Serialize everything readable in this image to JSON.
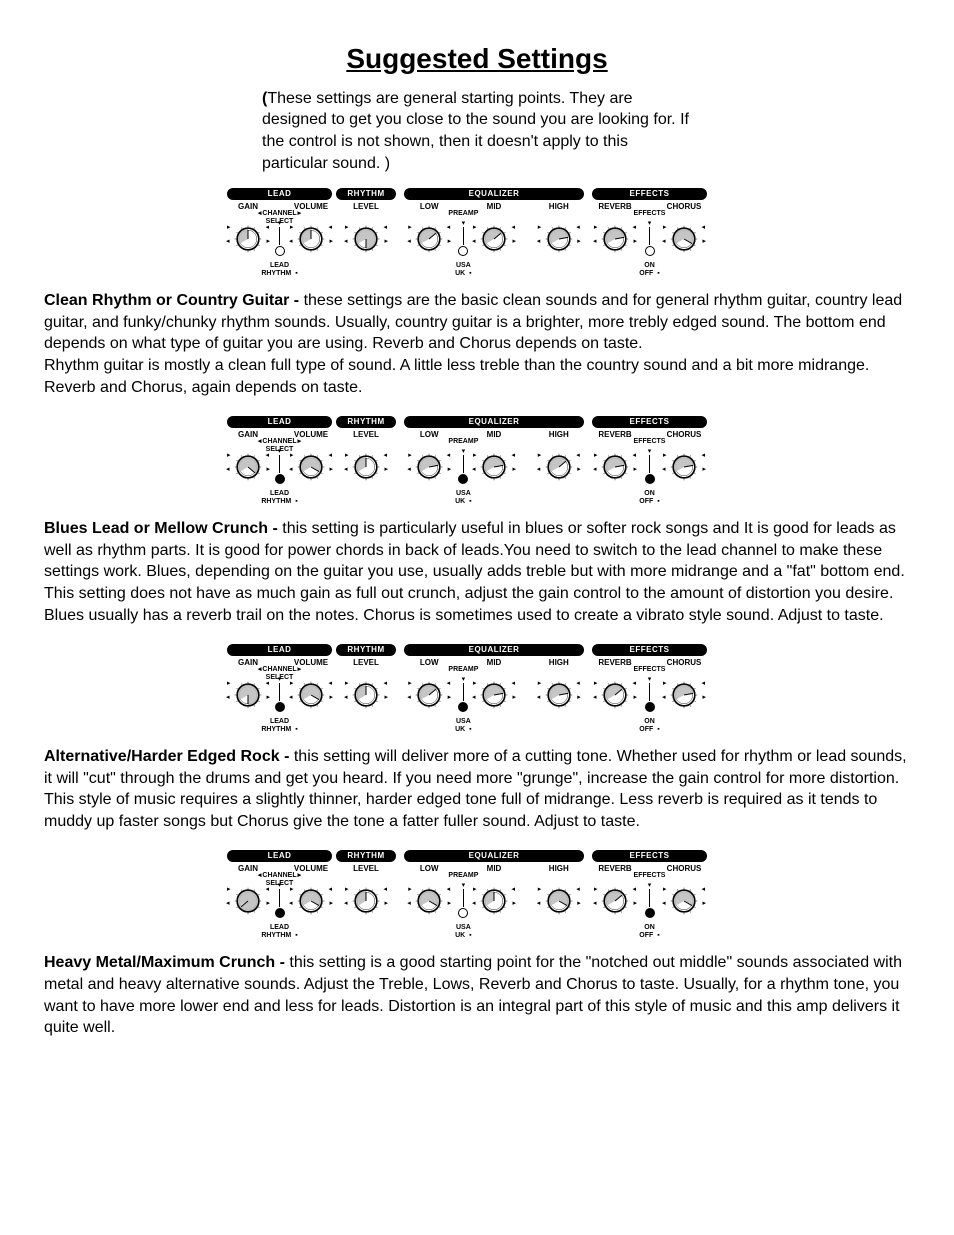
{
  "title": "Suggested Settings",
  "intro_open": "(",
  "intro": "These settings are general starting points. They are designed to get you close to the sound you are looking for. If the control is not shown, then it doesn't apply to this particular sound. )",
  "panel_labels": {
    "lead": "LEAD",
    "rhythm": "RHYTHM",
    "equalizer": "EQUALIZER",
    "effects": "EFFECTS",
    "gain": "GAIN",
    "channel": "CHANNEL",
    "select": "SELECT",
    "volume": "VOLUME",
    "level": "LEVEL",
    "low": "LOW",
    "preamp": "PREAMP",
    "mid": "MID",
    "high": "HIGH",
    "reverb": "REVERB",
    "effects_mid": "EFFECTS",
    "chorus": "CHORUS",
    "lead_rhythm": "LEAD\nRHYTHM",
    "usa_uk": "USA\nUK",
    "on_off": "ON\nOFF"
  },
  "sections": [
    {
      "heading": "Clean Rhythm or Country Guitar -",
      "body": " these settings are the basic clean sounds and for general rhythm guitar, country lead guitar, and funky/chunky rhythm sounds. Usually, country guitar is a brighter, more trebly edged sound. The bottom end depends on what type of guitar you are using. Reverb and Chorus depends on taste.\nRhythm guitar is mostly a clean full type of sound. A little less treble than the country sound and a bit more midrange. Reverb and Chorus, again depends on taste.",
      "panel": {
        "gain": 120,
        "volume": 120,
        "level": 300,
        "low": 170,
        "mid": 170,
        "high": 200,
        "reverb": 200,
        "chorus": 240,
        "channel_filled": false,
        "preamp_filled": false,
        "effects_filled": false
      }
    },
    {
      "heading": "Blues Lead or Mellow Crunch -",
      "body": " this setting is particularly useful in blues or softer rock songs and It is good for leads as well as rhythm parts. It is good for power chords in back of leads.You need to switch to the lead channel to make these settings work. Blues, depending on the guitar you use, usually adds treble but with more midrange and a \"fat\" bottom end. This setting does not have as much gain as full out crunch, adjust the gain control to the amount of distortion you desire.  Blues usually has a reverb trail on the notes. Chorus is sometimes used to create a vibrato style sound. Adjust to taste.",
      "panel": {
        "gain": 250,
        "volume": 240,
        "level": 120,
        "low": 200,
        "mid": 200,
        "high": 170,
        "reverb": 200,
        "chorus": 200,
        "channel_filled": true,
        "preamp_filled": true,
        "effects_filled": true
      }
    },
    {
      "heading": "Alternative/Harder Edged Rock -",
      "body": " this setting will deliver more of a cutting tone. Whether used for rhythm or lead sounds, it will \"cut\"  through the drums and get you heard. If you need more \"grunge\", increase the gain control for more distortion. This style of music requires a  slightly thinner, harder edged tone full of midrange. Less reverb is required as it tends to muddy up faster songs but Chorus give the tone a fatter fuller sound. Adjust to taste.",
      "panel": {
        "gain": 300,
        "volume": 240,
        "level": 120,
        "low": 170,
        "mid": 200,
        "high": 200,
        "reverb": 170,
        "chorus": 200,
        "channel_filled": true,
        "preamp_filled": true,
        "effects_filled": true
      }
    },
    {
      "heading": "Heavy Metal/Maximum Crunch -",
      "body": " this setting is a good starting point for the \"notched out middle\" sounds associated with metal and heavy alternative sounds. Adjust the Treble, Lows, Reverb and Chorus  to taste. Usually, for a rhythm tone, you want to have more lower end and less for leads. Distortion is an integral part of this style of music and this amp delivers it quite well.",
      "panel": {
        "gain": 350,
        "volume": 240,
        "level": 120,
        "low": 240,
        "mid": 120,
        "high": 240,
        "reverb": 170,
        "chorus": 240,
        "channel_filled": true,
        "preamp_filled": false,
        "effects_filled": true
      }
    }
  ]
}
